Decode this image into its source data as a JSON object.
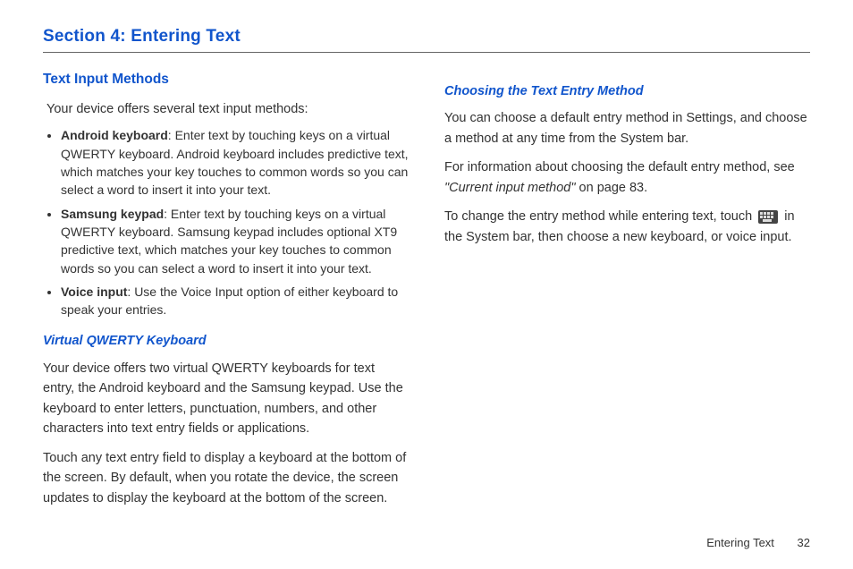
{
  "section_title": "Section 4: Entering Text",
  "left": {
    "heading": "Text Input Methods",
    "intro": "Your device offers several text input methods:",
    "bullets": [
      {
        "label": "Android keyboard",
        "text": ": Enter text by touching keys on a virtual QWERTY keyboard. Android keyboard includes predictive text, which matches your key touches to common words so you can select a word to insert it into your text."
      },
      {
        "label": "Samsung keypad",
        "text": ": Enter text by touching keys on a virtual QWERTY keyboard. Samsung keypad includes optional XT9 predictive text, which matches your key touches to common words so you can select a word to insert it into your text."
      },
      {
        "label": "Voice input",
        "text": ": Use the Voice Input option of either keyboard to speak your entries."
      }
    ],
    "sub1_heading": "Virtual QWERTY Keyboard",
    "sub1_p1": "Your device offers two virtual QWERTY keyboards for text entry, the Android keyboard and the Samsung keypad. Use the keyboard to enter letters, punctuation, numbers, and other characters into text entry fields or applications.",
    "sub1_p2": "Touch any text entry field to display a keyboard at the bottom of the screen. By default, when you rotate the device, the screen updates to display the keyboard at the bottom of the screen."
  },
  "right": {
    "sub_heading": "Choosing the Text Entry Method",
    "p1": "You can choose a default entry method in Settings, and choose a method at any time from the System bar.",
    "p2_pre": "For information about choosing the default entry method, see ",
    "p2_ref": "\"Current input method\"",
    "p2_post": " on page 83.",
    "p3_pre": "To change the entry method while entering text, touch ",
    "p3_post": " in the System bar, then choose a new keyboard, or voice input."
  },
  "footer": {
    "label": "Entering Text",
    "page": "32"
  }
}
